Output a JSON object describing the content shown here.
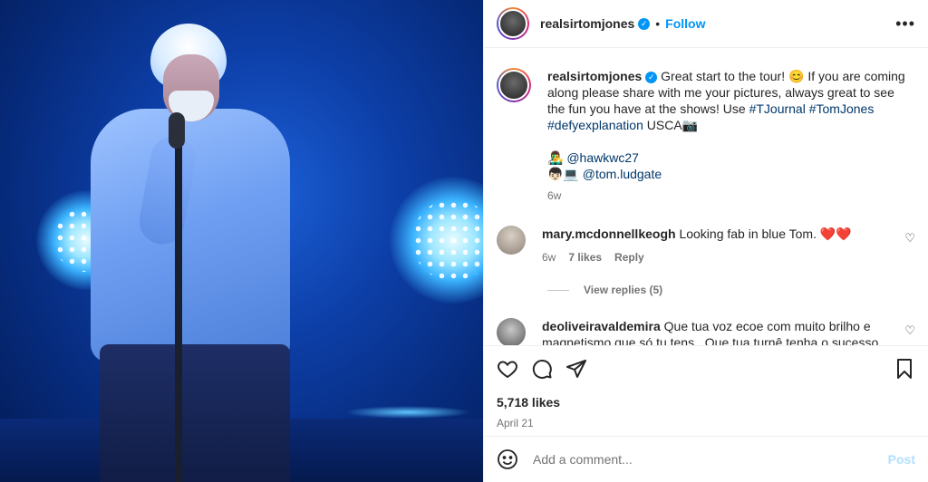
{
  "post": {
    "username": "realsirtomjones",
    "follow_label": "Follow",
    "more_label": "•••",
    "caption_main": " Great start to the tour! 😊 If you are coming along please share with me your pictures, always great to see the fun you have at the shows! Use ",
    "hashtags": [
      "#TJournal",
      "#TomJones",
      "#defyexplanation"
    ],
    "caption_tail": " USCA📷",
    "credits": [
      {
        "emoji": "👨‍🎤",
        "handle": "@hawkwc27"
      },
      {
        "emoji": "👦🏻💻",
        "handle": "@tom.ludgate"
      }
    ],
    "time_ago": "6w"
  },
  "comments": [
    {
      "username": "mary.mcdonnellkeogh",
      "text": "Looking fab in blue Tom. ❤️❤️",
      "time_ago": "6w",
      "likes": "7 likes",
      "reply_label": "Reply",
      "view_replies": "View replies (5)"
    },
    {
      "username": "deoliveiravaldemira",
      "text": "Que tua voz ecoe com muito brilho e magnetismo que só tu tens . Que tua turnê tenha o sucesso de"
    }
  ],
  "stats": {
    "likes": "5,718 likes",
    "date": "April 21"
  },
  "comment_box": {
    "placeholder": "Add a comment...",
    "post_label": "Post"
  },
  "icons": {
    "like": "heart-icon",
    "comment": "comment-icon",
    "share": "send-icon",
    "save": "bookmark-icon",
    "emoji": "emoji-icon"
  },
  "colors": {
    "accent": "#0095f6",
    "hashtag": "#00376b",
    "muted": "#737373"
  }
}
